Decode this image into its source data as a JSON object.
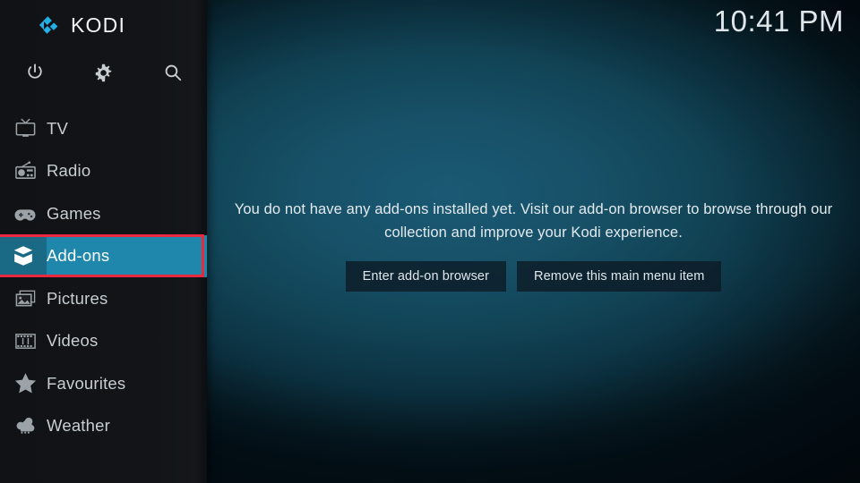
{
  "app": {
    "brand_name": "KODI",
    "logo_icon": "kodi-logo-icon",
    "accent_color": "#1f87ab",
    "accent_icon_color": "#1a6a85",
    "annotation_color": "#e8293f"
  },
  "header": {
    "clock": "10:41 PM"
  },
  "toolbar": {
    "items": [
      {
        "icon": "power-icon",
        "label": "Power"
      },
      {
        "icon": "gear-icon",
        "label": "Settings"
      },
      {
        "icon": "search-icon",
        "label": "Search"
      }
    ]
  },
  "sidebar": {
    "items": [
      {
        "label": "TV",
        "icon": "tv-icon",
        "selected": false
      },
      {
        "label": "Radio",
        "icon": "radio-icon",
        "selected": false
      },
      {
        "label": "Games",
        "icon": "gamepad-icon",
        "selected": false
      },
      {
        "label": "Add-ons",
        "icon": "box-icon",
        "selected": true
      },
      {
        "label": "Pictures",
        "icon": "picture-icon",
        "selected": false
      },
      {
        "label": "Videos",
        "icon": "film-icon",
        "selected": false
      },
      {
        "label": "Favourites",
        "icon": "star-icon",
        "selected": false
      },
      {
        "label": "Weather",
        "icon": "weather-icon",
        "selected": false
      }
    ]
  },
  "main": {
    "empty_message": "You do not have any add-ons installed yet. Visit our add-on browser to browse through our collection and improve your Kodi experience.",
    "buttons": [
      {
        "label": "Enter add-on browser"
      },
      {
        "label": "Remove this main menu item"
      }
    ]
  }
}
